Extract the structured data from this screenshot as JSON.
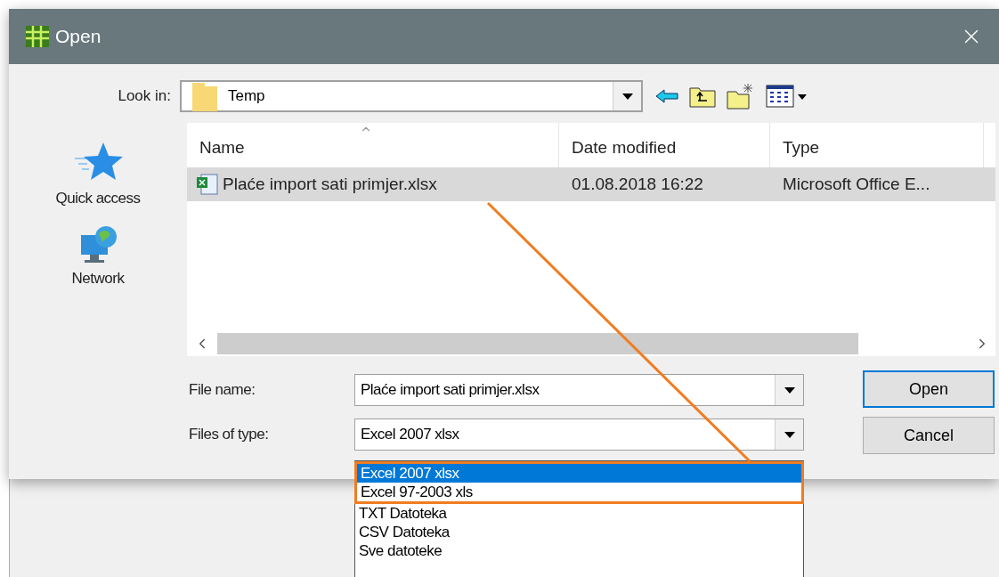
{
  "window": {
    "title": "Open"
  },
  "look_in": {
    "label": "Look in:",
    "value": "Temp"
  },
  "places": [
    {
      "label": "Quick access",
      "kind": "star"
    },
    {
      "label": "Network",
      "kind": "globe"
    }
  ],
  "file_list": {
    "columns": [
      "Name",
      "Date modified",
      "Type"
    ],
    "rows": [
      {
        "cells": [
          "Plaće import sati primjer.xlsx",
          "01.08.2018 16:22",
          "Microsoft Office E..."
        ],
        "selected": true
      }
    ]
  },
  "file_name": {
    "label": "File name:",
    "value": "Plaće import sati primjer.xlsx"
  },
  "file_type": {
    "label": "Files of type:",
    "value": "Excel 2007 xlsx",
    "options": [
      {
        "label": "Excel 2007 xlsx",
        "selected": true,
        "highlighted": true
      },
      {
        "label": "Excel 97-2003 xls",
        "selected": false,
        "highlighted": true
      },
      {
        "label": "TXT Datoteka",
        "selected": false,
        "highlighted": false
      },
      {
        "label": "CSV Datoteka",
        "selected": false,
        "highlighted": false
      },
      {
        "label": "Sve datoteke",
        "selected": false,
        "highlighted": false
      }
    ]
  },
  "buttons": [
    "Open",
    "Cancel"
  ]
}
